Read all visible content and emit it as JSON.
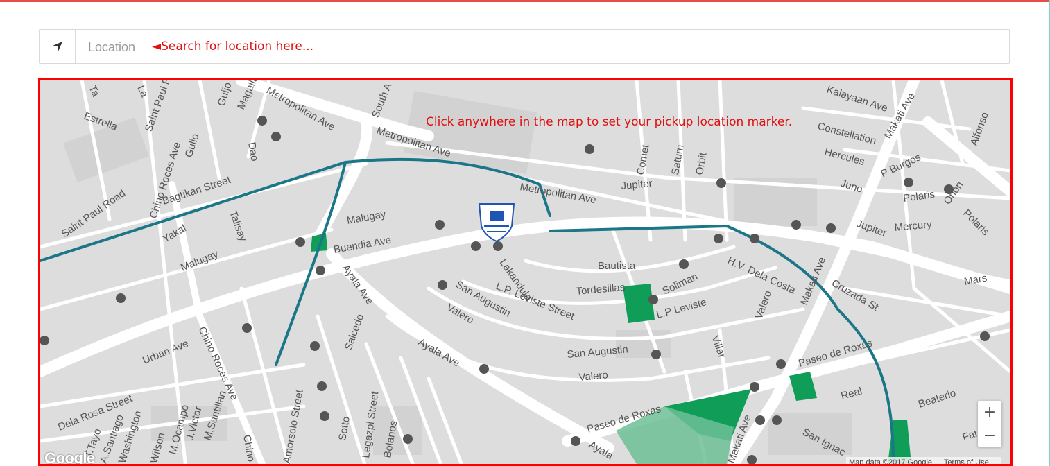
{
  "location": {
    "placeholder": "Location",
    "hint": "◄Search for location here...",
    "icon": "location-arrow-icon"
  },
  "map": {
    "hint": "Click anywhere in the map to set your pickup location marker.",
    "zoom_in": "+",
    "zoom_out": "−",
    "logo": "Google",
    "attribution": "Map data ©2017 Google",
    "terms": "Terms of Use",
    "marker_icon": "school-logo-marker",
    "colors": {
      "border": "#ff0000",
      "hint": "#e01010",
      "water": "#1b7788",
      "park": "#0f9d58",
      "road": "#ffffff",
      "land": "#dddddd"
    },
    "labels": [
      "Ta",
      "La",
      "Estrella",
      "Saint Paul R",
      "Guijo",
      "Magallanes",
      "Metropolitan Ave",
      "South A",
      "Dao",
      "Chino Roces Ave",
      "Gulio",
      "Bagtikan Street",
      "Saint Paul Road",
      "Yakal",
      "Talisay",
      "Malugay",
      "Buendia Ave",
      "Metropolitan Ave",
      "Metropolitan Ave",
      "Jupiter",
      "Comet",
      "Saturn",
      "Orbit",
      "Constellation",
      "Hercules",
      "Juno",
      "Kalayaan Ave",
      "Makati Ave",
      "P Burgos",
      "Polaris",
      "Orion",
      "Alfonso",
      "Jupiter",
      "Mercury",
      "Polaris",
      "Bautista",
      "H.V. Dela Costa",
      "Tordesillas",
      "Soliman",
      "L.P Leviste",
      "Lakandula",
      "L.P. Leviste Street",
      "San Augustin",
      "Valero",
      "Ayala Ave",
      "Malugay",
      "Urban Ave",
      "Chino Roces Ave",
      "Salcedo",
      "San Augustin",
      "Valero",
      "Villar",
      "Valero",
      "Makati Ave",
      "Cruzada St",
      "Mars",
      "Paseo de Roxas",
      "Paseo de Roxas",
      "Real",
      "Beaterio",
      "Farol",
      "San Ignac",
      "Ayala Ave",
      "Dela Rosa Street",
      "T.Tayo",
      "A.Santiago",
      "Washington",
      "Wilson",
      "M.Ocampo",
      "J.Victor",
      "M.Santillan",
      "Amorsolo Street",
      "Sotto",
      "Legazpi Street",
      "Bolanos",
      "Makati Ave",
      "Chino",
      "Ayala"
    ]
  }
}
